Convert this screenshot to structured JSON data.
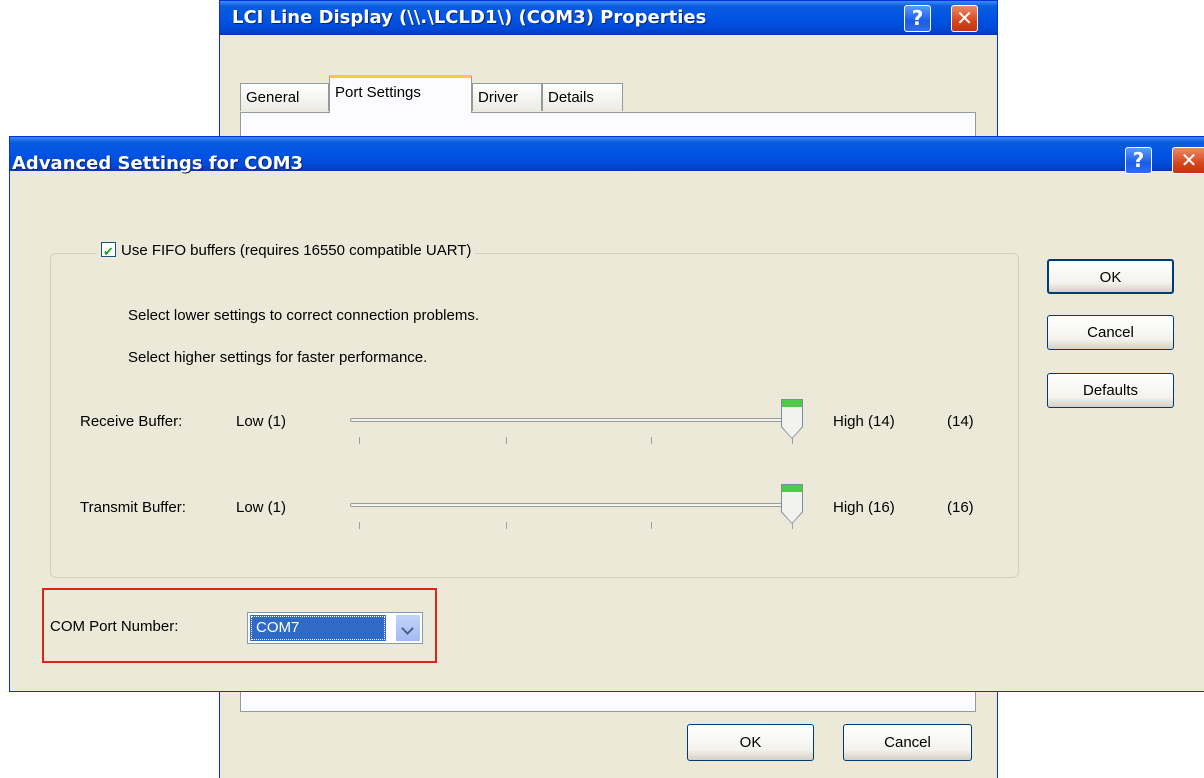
{
  "back_dialog": {
    "title": "LCI Line Display (\\\\.\\LCLD1\\) (COM3) Properties",
    "tabs": [
      "General",
      "Port Settings",
      "Driver",
      "Details"
    ],
    "active_tab": "Port Settings",
    "ok_label": "OK",
    "cancel_label": "Cancel"
  },
  "front_dialog": {
    "title": "Advanced Settings for COM3",
    "fifo_label": "Use FIFO buffers (requires 16550 compatible UART)",
    "fifo_checked": true,
    "hint_lower": "Select lower settings to correct connection problems.",
    "hint_higher": "Select higher settings for faster performance.",
    "receive": {
      "label": "Receive Buffer:",
      "low": "Low (1)",
      "high": "High (14)",
      "current": "(14)",
      "value": 14,
      "min": 1,
      "max": 14
    },
    "transmit": {
      "label": "Transmit Buffer:",
      "low": "Low (1)",
      "high": "High (16)",
      "current": "(16)",
      "value": 16,
      "min": 1,
      "max": 16
    },
    "com_port_label": "COM Port Number:",
    "com_port_value": "COM7",
    "buttons": {
      "ok": "OK",
      "cancel": "Cancel",
      "defaults": "Defaults"
    }
  },
  "colors": {
    "titlebar": "#0054e3",
    "dialog_bg": "#ece9d8",
    "highlight": "#316ac5",
    "annotation_box": "#e0241b",
    "slider_thumb": "#53c948"
  }
}
